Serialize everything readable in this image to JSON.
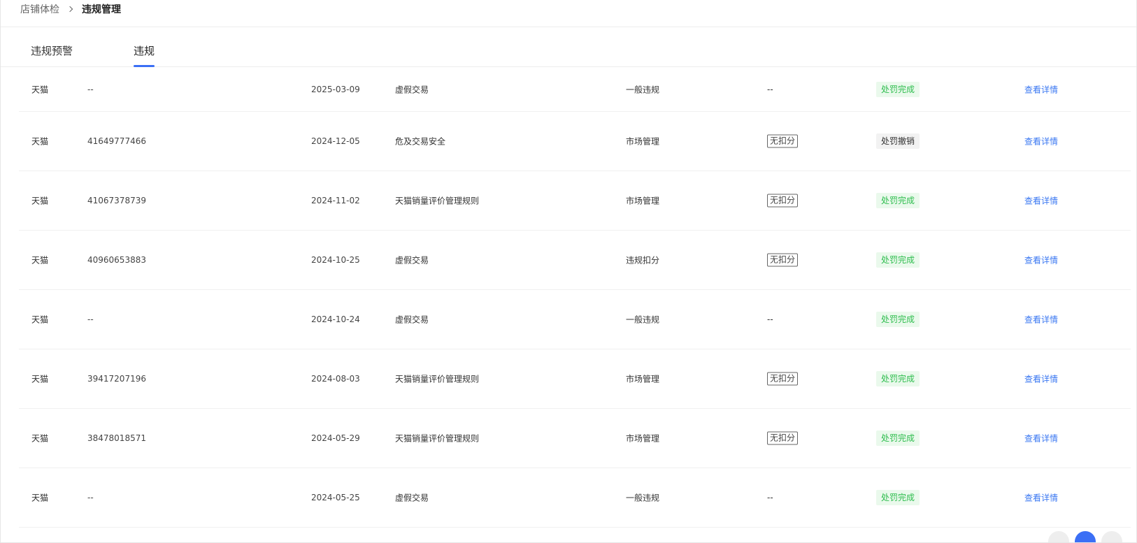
{
  "breadcrumb": {
    "parent": "店铺体检",
    "current": "违规管理"
  },
  "tabs": [
    {
      "label": "违规预警",
      "active": false
    },
    {
      "label": "违规",
      "active": true
    }
  ],
  "rows": [
    {
      "platform": "天猫",
      "id": "--",
      "date": "2025-03-09",
      "type": "虚假交易",
      "level": "一般违规",
      "score": "--",
      "status": "处罚完成",
      "action": "查看详情"
    },
    {
      "platform": "天猫",
      "id": "41649777466",
      "date": "2024-12-05",
      "type": "危及交易安全",
      "level": "市场管理",
      "score": "无扣分",
      "status": "处罚撤销",
      "action": "查看详情"
    },
    {
      "platform": "天猫",
      "id": "41067378739",
      "date": "2024-11-02",
      "type": "天猫销量评价管理规则",
      "level": "市场管理",
      "score": "无扣分",
      "status": "处罚完成",
      "action": "查看详情"
    },
    {
      "platform": "天猫",
      "id": "40960653883",
      "date": "2024-10-25",
      "type": "虚假交易",
      "level": "违规扣分",
      "score": "无扣分",
      "status": "处罚完成",
      "action": "查看详情"
    },
    {
      "platform": "天猫",
      "id": "--",
      "date": "2024-10-24",
      "type": "虚假交易",
      "level": "一般违规",
      "score": "--",
      "status": "处罚完成",
      "action": "查看详情"
    },
    {
      "platform": "天猫",
      "id": "39417207196",
      "date": "2024-08-03",
      "type": "天猫销量评价管理规则",
      "level": "市场管理",
      "score": "无扣分",
      "status": "处罚完成",
      "action": "查看详情"
    },
    {
      "platform": "天猫",
      "id": "38478018571",
      "date": "2024-05-29",
      "type": "天猫销量评价管理规则",
      "level": "市场管理",
      "score": "无扣分",
      "status": "处罚完成",
      "action": "查看详情"
    },
    {
      "platform": "天猫",
      "id": "--",
      "date": "2024-05-25",
      "type": "虚假交易",
      "level": "一般违规",
      "score": "--",
      "status": "处罚完成",
      "action": "查看详情"
    }
  ],
  "colors": {
    "accent": "#3b6ff5",
    "link": "#3b78f2",
    "success_text": "#2dbd4d",
    "success_bg": "#eaf9ec"
  }
}
